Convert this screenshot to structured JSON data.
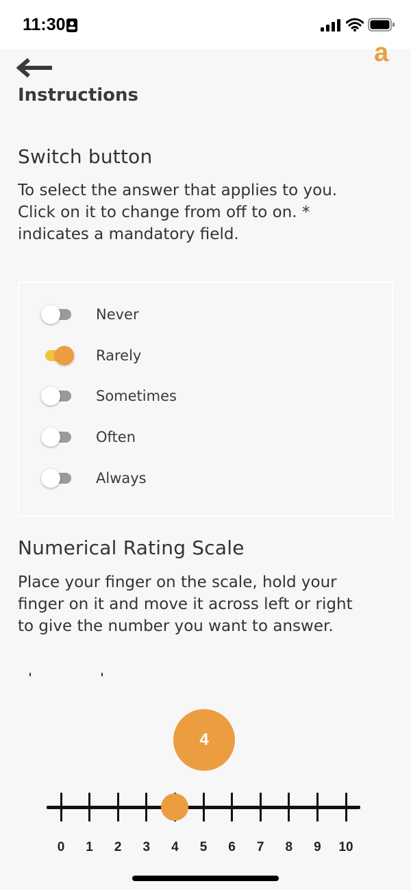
{
  "status_bar": {
    "time": "11:30"
  },
  "header": {
    "brand_letter": "a",
    "title": "Instructions"
  },
  "switch_section": {
    "title": "Switch button",
    "description_lines": [
      "To select the answer that applies to you.",
      "Click on it to change from off to on.  *",
      "indicates a mandatory field."
    ],
    "options": [
      {
        "label": "Never",
        "on": false
      },
      {
        "label": "Rarely",
        "on": true
      },
      {
        "label": "Sometimes",
        "on": false
      },
      {
        "label": "Often",
        "on": false
      },
      {
        "label": "Always",
        "on": false
      }
    ]
  },
  "rating_section": {
    "title": "Numerical Rating Scale",
    "description_lines": [
      "Place your finger on the scale, hold your",
      "finger on it and move it across left or right",
      "to give the  number you want to answer."
    ],
    "min": 0,
    "max": 10,
    "value": 4,
    "value_display": "4",
    "labels": [
      "0",
      "1",
      "2",
      "3",
      "4",
      "5",
      "6",
      "7",
      "8",
      "9",
      "10"
    ]
  },
  "colors": {
    "accent": "#ec9d3f",
    "switch_track_on": "#f1c33c",
    "switch_track_off": "#9a9a9a",
    "background": "#f7f7f7"
  }
}
